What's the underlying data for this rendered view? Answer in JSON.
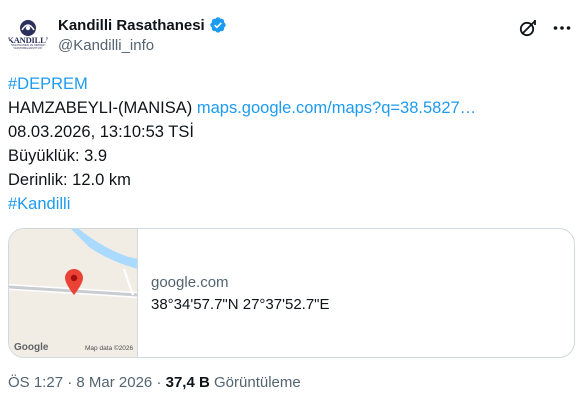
{
  "author": {
    "display_name": "Kandilli Rasathanesi",
    "handle": "@Kandilli_info",
    "verified": true,
    "avatar_logo_text": "KANDILLI",
    "avatar_logo_sub": "RASATHANESİ VE DEPREM ARAŞTIRMA ENSTİTÜSÜ"
  },
  "post": {
    "hashtag_top": "#DEPREM",
    "location": "HAMZABEYLI-(MANISA)",
    "map_link": "maps.google.com/maps?q=38.5827…",
    "datetime": "08.03.2026, 13:10:53 TSİ",
    "magnitude": "Büyüklük: 3.9",
    "depth": "Derinlik: 12.0 km",
    "hashtag_bottom": "#Kandilli"
  },
  "card": {
    "domain": "google.com",
    "title": "38°34'57.7\"N 27°37'52.7\"E",
    "map_brand": "Google",
    "map_data": "Map data ©2026"
  },
  "footer": {
    "time": "ÖS 1:27",
    "separator": " · ",
    "date": "8 Mar 2026",
    "views_count": "37,4 B",
    "views_label": "Görüntüleme"
  },
  "colors": {
    "link": "#1d9bf0",
    "muted": "#536471",
    "text": "#0f1419",
    "verified_badge": "#1d9bf0",
    "map_pin": "#ea4335"
  },
  "icons": {
    "verified": "verified-badge-icon",
    "grok": "grok-icon",
    "more": "more-icon",
    "pin": "map-pin-icon"
  }
}
